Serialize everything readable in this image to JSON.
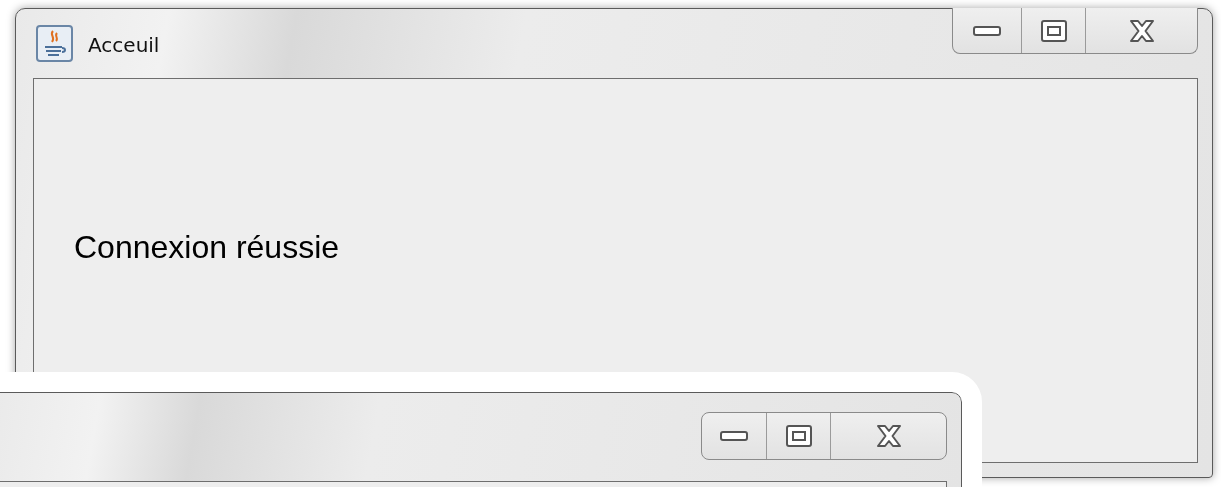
{
  "windows": [
    {
      "kind": "message_window",
      "title": "Acceuil",
      "message": "Connexion réussie"
    },
    {
      "kind": "blank_window"
    }
  ]
}
